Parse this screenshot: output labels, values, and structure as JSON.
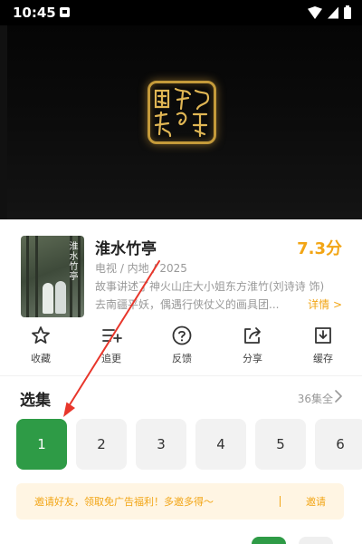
{
  "status_bar": {
    "time": "10:45"
  },
  "movie": {
    "poster_title": "淮水竹亭",
    "title": "淮水竹亭",
    "score": "7.3分",
    "meta": "电视 / 内地 / 2025",
    "desc_line1": "故事讲述了神火山庄大小姐东方淮竹(刘诗诗 饰)",
    "desc_line2": "去南疆平妖，偶遇行侠仗义的画具团...",
    "more_label": "详情 >"
  },
  "actions": [
    {
      "label": "收藏",
      "icon": "star-icon"
    },
    {
      "label": "追更",
      "icon": "add-list-icon"
    },
    {
      "label": "反馈",
      "icon": "question-icon"
    },
    {
      "label": "分享",
      "icon": "share-icon"
    },
    {
      "label": "缓存",
      "icon": "download-icon"
    }
  ],
  "episodes": {
    "title": "选集",
    "count": "36集全",
    "items": [
      "1",
      "2",
      "3",
      "4",
      "5",
      "6"
    ],
    "selected": "1"
  },
  "invite": {
    "text": "邀请好友，领取免广告福利！多邀多得～",
    "button": "邀请"
  },
  "colors": {
    "accent_orange": "#f2a515",
    "accent_green": "#2e9b46",
    "annotation_red": "#e8362b"
  }
}
